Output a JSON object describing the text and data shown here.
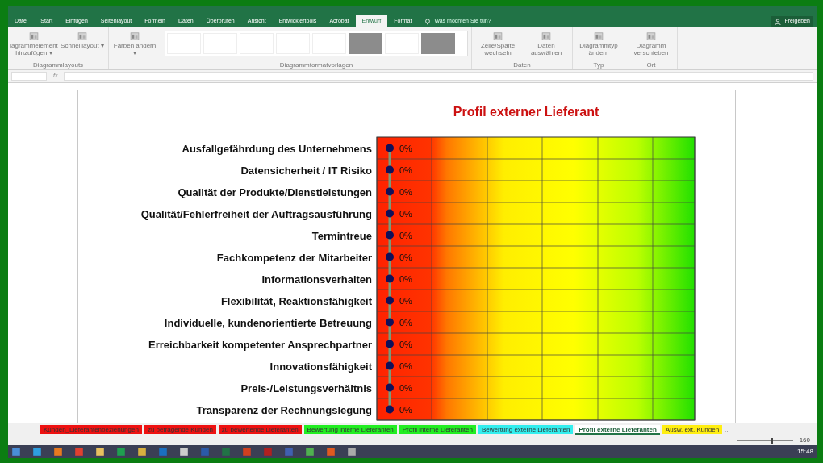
{
  "ribbon_tabs": [
    {
      "label": "Datei",
      "selected": false
    },
    {
      "label": "Start",
      "selected": false
    },
    {
      "label": "Einfügen",
      "selected": false
    },
    {
      "label": "Seitenlayout",
      "selected": false
    },
    {
      "label": "Formeln",
      "selected": false
    },
    {
      "label": "Daten",
      "selected": false
    },
    {
      "label": "Überprüfen",
      "selected": false
    },
    {
      "label": "Ansicht",
      "selected": false
    },
    {
      "label": "Entwicklertools",
      "selected": false
    },
    {
      "label": "Acrobat",
      "selected": false
    },
    {
      "label": "Entwurf",
      "selected": true
    },
    {
      "label": "Format",
      "selected": false
    }
  ],
  "tell_me": {
    "placeholder": "Was möchten Sie tun?"
  },
  "share_button": "Freigeben",
  "ribbon_groups": [
    {
      "label": "Diagrammlayouts",
      "commands": [
        "iagrammelement hinzufügen ▾",
        "Schnelllayout ▾"
      ]
    },
    {
      "commands": [
        "Farben ändern ▾"
      ]
    },
    {
      "label": "Diagrammformatvorlagen",
      "kind": "gallery",
      "styles": [
        {
          "dark": false
        },
        {
          "dark": false
        },
        {
          "dark": false
        },
        {
          "dark": false
        },
        {
          "dark": false
        },
        {
          "dark": true
        },
        {
          "dark": false
        },
        {
          "dark": true
        }
      ]
    },
    {
      "label": "Daten",
      "commands": [
        "Zeile/Spalte wechseln",
        "Daten auswählen"
      ]
    },
    {
      "label": "Typ",
      "commands": [
        "Diagrammtyp ändern"
      ]
    },
    {
      "label": "Ort",
      "commands": [
        "Diagramm verschieben"
      ]
    }
  ],
  "formula_bar": {
    "fx": "fx"
  },
  "chart": {
    "title": "Profil externer Lieferant",
    "rows": [
      {
        "label": "Ausfallgefährdung des Unternehmens",
        "value_label": "0%"
      },
      {
        "label": "Datensicherheit / IT Risiko",
        "value_label": "0%"
      },
      {
        "label": "Qualität der Produkte/Dienstleistungen",
        "value_label": "0%"
      },
      {
        "label": "Qualität/Fehlerfreiheit der Auftragsausführung",
        "value_label": "0%"
      },
      {
        "label": "Termintreue",
        "value_label": "0%"
      },
      {
        "label": "Fachkompetenz der Mitarbeiter",
        "value_label": "0%"
      },
      {
        "label": "Informationsverhalten",
        "value_label": "0%"
      },
      {
        "label": "Flexibilität, Reaktionsfähigkeit",
        "value_label": "0%"
      },
      {
        "label": "Individuelle, kundenorientierte Betreuung",
        "value_label": "0%"
      },
      {
        "label": "Erreichbarkeit kompetenter Ansprechpartner",
        "value_label": "0%"
      },
      {
        "label": "Innovationsfähigkeit",
        "value_label": "0%"
      },
      {
        "label": "Preis-/Leistungsverhältnis",
        "value_label": "0%"
      },
      {
        "label": "Transparenz der Rechnungslegung",
        "value_label": "0%"
      }
    ]
  },
  "sheet_tabs": [
    {
      "label": "Kunden_Lieferantenbeziehungen",
      "color": "#ee1111",
      "selected": false
    },
    {
      "label": "zu befragende Kunden",
      "color": "#ee1111",
      "selected": false
    },
    {
      "label": "zu bewertende Lieferanten",
      "color": "#ee1111",
      "selected": false
    },
    {
      "label": "Bewertung interne Lieferanten",
      "color": "#22ee22",
      "selected": false
    },
    {
      "label": "Profil interne Lieferanten",
      "color": "#22ee22",
      "selected": false
    },
    {
      "label": "Bewertung externe Lieferanten",
      "color": "#33eeee",
      "selected": false
    },
    {
      "label": "Profil externe Lieferanten",
      "color": "#ffffff",
      "selected": true
    },
    {
      "label": "Ausw. ext. Kunden",
      "color": "#ffee11",
      "selected": false
    }
  ],
  "more_tabs": "...",
  "zoom": {
    "level": 0.62,
    "reading": "160"
  },
  "clock": "15:48"
}
